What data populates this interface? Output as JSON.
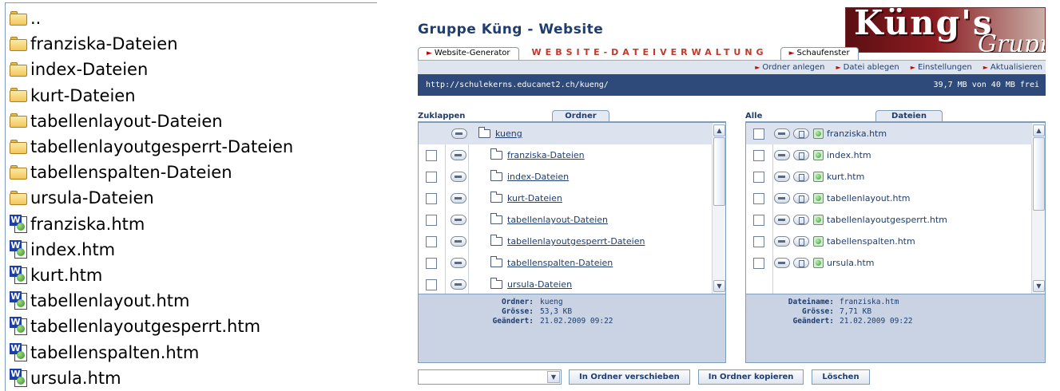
{
  "explorer": {
    "items": [
      {
        "type": "folder",
        "label": ".."
      },
      {
        "type": "folder",
        "label": "franziska-Dateien"
      },
      {
        "type": "folder",
        "label": "index-Dateien"
      },
      {
        "type": "folder",
        "label": "kurt-Dateien"
      },
      {
        "type": "folder",
        "label": "tabellenlayout-Dateien"
      },
      {
        "type": "folder",
        "label": "tabellenlayoutgesperrt-Dateien"
      },
      {
        "type": "folder",
        "label": "tabellenspalten-Dateien"
      },
      {
        "type": "folder",
        "label": "ursula-Dateien"
      },
      {
        "type": "document",
        "label": "franziska.htm"
      },
      {
        "type": "document",
        "label": "index.htm"
      },
      {
        "type": "document",
        "label": "kurt.htm"
      },
      {
        "type": "document",
        "label": "tabellenlayout.htm"
      },
      {
        "type": "document",
        "label": "tabellenlayoutgesperrt.htm"
      },
      {
        "type": "document",
        "label": "tabellenspalten.htm"
      },
      {
        "type": "document",
        "label": "ursula.htm"
      }
    ]
  },
  "webapp": {
    "title": "Gruppe Küng - Website",
    "logo": {
      "line1": "Küng's",
      "line2": "Gruppe"
    },
    "tabs": {
      "generator": "Website-Generator",
      "active": "WEBSITE-DATEIVERWALTUNG",
      "schaufenster": "Schaufenster"
    },
    "actions": [
      "Ordner anlegen",
      "Datei ablegen",
      "Einstellungen",
      "Aktualisieren"
    ],
    "url": "http://schulekerns.educanet2.ch/kueng/",
    "quota": "39,7 MB von 40 MB frei",
    "folders_pane": {
      "left_label": "Zuklappen",
      "tab": "Ordner",
      "root": "kueng",
      "items": [
        "franziska-Dateien",
        "index-Dateien",
        "kurt-Dateien",
        "tabellenlayout-Dateien",
        "tabellenlayoutgesperrt-Dateien",
        "tabellenspalten-Dateien",
        "ursula-Dateien"
      ],
      "info": {
        "k1": "Ordner:",
        "v1": "kueng",
        "k2": "Grösse:",
        "v2": "53,3 KB",
        "k3": "Geändert:",
        "v3": "21.02.2009 09:22"
      }
    },
    "files_pane": {
      "left_label": "Alle",
      "tab": "Dateien",
      "items": [
        "franziska.htm",
        "index.htm",
        "kurt.htm",
        "tabellenlayout.htm",
        "tabellenlayoutgesperrt.htm",
        "tabellenspalten.htm",
        "ursula.htm"
      ],
      "info": {
        "k1": "Dateiname:",
        "v1": "franziska.htm",
        "k2": "Grösse:",
        "v2": "7,71 KB",
        "k3": "Geändert:",
        "v3": "21.02.2009 09:22"
      }
    },
    "bottom": {
      "select_value": "",
      "move_label": "In Ordner verschieben",
      "copy_label": "In Ordner kopieren",
      "delete_label": "Löschen"
    },
    "colors": {
      "accent": "#c0392b",
      "navy": "#2d4a7a",
      "text": "#1f3d6e",
      "info_bg": "#c9d3e3"
    }
  }
}
